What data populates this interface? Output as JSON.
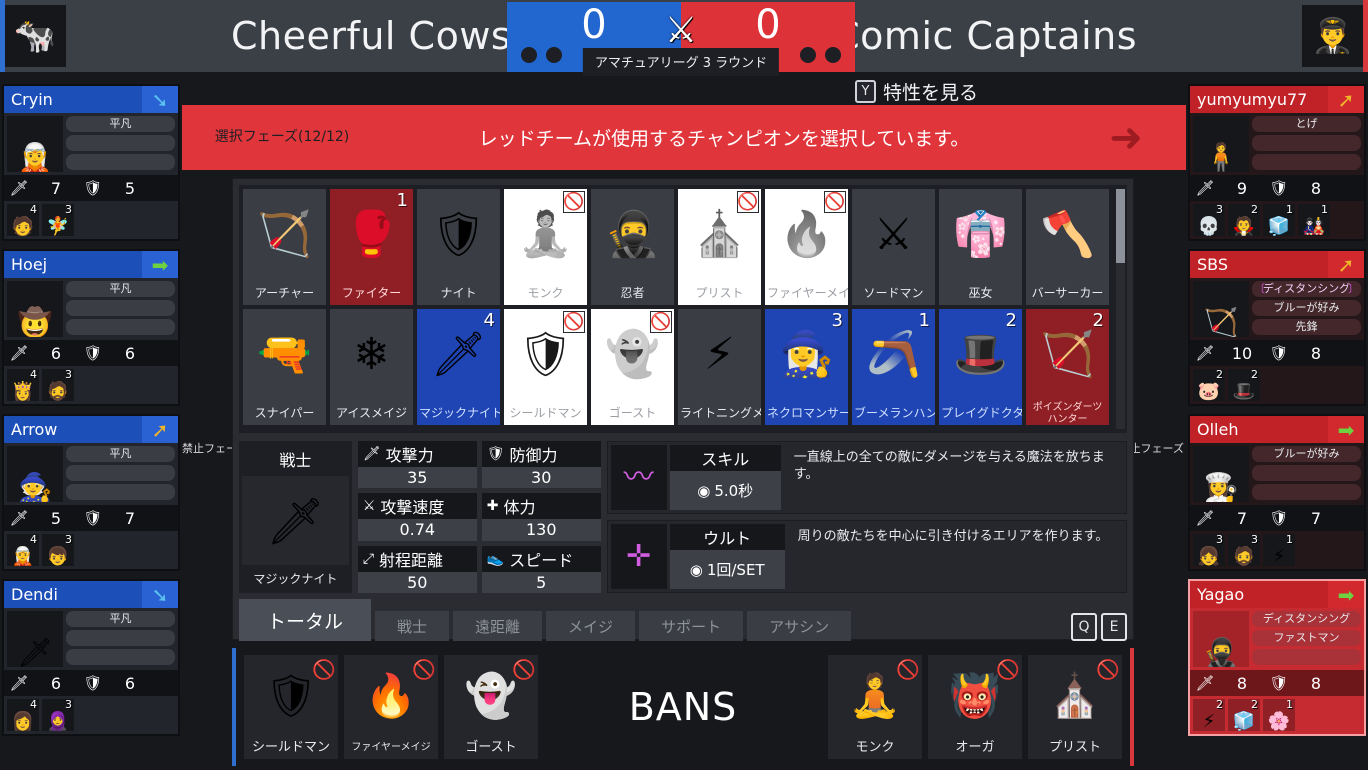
{
  "header": {
    "blue_team": "Cheerful Cows",
    "red_team": "Comic Captains",
    "blue_logo_icon": "cow-icon",
    "red_logo_icon": "captain-icon",
    "blue_score": "0",
    "red_score": "0",
    "round_label": "アマチュアリーグ 3 ラウンド",
    "swords_icon": "crossed-swords-icon",
    "traits_key": "Y",
    "traits_label": "特性を見る"
  },
  "phase": {
    "count": "選択フェーズ(12/12)",
    "message": "レッドチームが使用するチャンピオンを選択しています。",
    "arrow_icon": "arrow-right-icon",
    "ban_tag_left": "禁止フェーズ",
    "ban_tag_right": "禁止フェーズ"
  },
  "blue_players": [
    {
      "name": "Cryin",
      "arrow": "arrow-down-right-icon",
      "portrait": "🧝",
      "traits": [
        "平凡",
        "",
        ""
      ],
      "attack": "7",
      "defense": "5",
      "champs": [
        {
          "icon": "🧑",
          "count": "4"
        },
        {
          "icon": "🧚",
          "count": "3"
        }
      ]
    },
    {
      "name": "Hoej",
      "arrow": "arrow-right-icon",
      "portrait": "🤠",
      "traits": [
        "平凡",
        "",
        ""
      ],
      "attack": "6",
      "defense": "6",
      "champs": [
        {
          "icon": "👸",
          "count": "4"
        },
        {
          "icon": "🧔",
          "count": "3"
        }
      ]
    },
    {
      "name": "Arrow",
      "arrow": "arrow-up-right-icon",
      "portrait": "🧙",
      "traits": [
        "平凡",
        "",
        ""
      ],
      "attack": "5",
      "defense": "7",
      "champs": [
        {
          "icon": "🧝",
          "count": "4"
        },
        {
          "icon": "👦",
          "count": "3"
        }
      ]
    },
    {
      "name": "Dendi",
      "arrow": "arrow-down-right-icon",
      "portrait": "🗡",
      "traits": [
        "平凡",
        "",
        ""
      ],
      "attack": "6",
      "defense": "6",
      "champs": [
        {
          "icon": "👩",
          "count": "4"
        },
        {
          "icon": "🧕",
          "count": "3"
        }
      ]
    }
  ],
  "red_players": [
    {
      "name": "yumyumyu77",
      "arrow": "arrow-up-right-icon",
      "portrait": "🧍",
      "traits": [
        "とげ",
        "",
        ""
      ],
      "attack": "9",
      "defense": "8",
      "active": false,
      "champs": [
        {
          "icon": "💀",
          "count": "3"
        },
        {
          "icon": "🧛",
          "count": "2"
        },
        {
          "icon": "🧊",
          "count": "1"
        },
        {
          "icon": "🎎",
          "count": "1"
        }
      ]
    },
    {
      "name": "SBS",
      "arrow": "arrow-up-right-icon",
      "portrait": "🏹",
      "traits": [
        "ディスタンシング",
        "ブルーが好み",
        "先鋒"
      ],
      "attack": "10",
      "defense": "8",
      "active": false,
      "trait_special": true,
      "champs": [
        {
          "icon": "🐷",
          "count": "2"
        },
        {
          "icon": "🎩",
          "count": "2"
        }
      ]
    },
    {
      "name": "Olleh",
      "arrow": "arrow-right-icon",
      "portrait": "👩‍🍳",
      "traits": [
        "ブルーが好み",
        "",
        ""
      ],
      "attack": "7",
      "defense": "7",
      "active": false,
      "champs": [
        {
          "icon": "👧",
          "count": "3"
        },
        {
          "icon": "🧔",
          "count": "3"
        },
        {
          "icon": "⚡",
          "count": "1"
        }
      ]
    },
    {
      "name": "Yagao",
      "arrow": "arrow-right-icon",
      "portrait": "🥷",
      "traits": [
        "ディスタンシング",
        "ファストマン",
        ""
      ],
      "attack": "8",
      "defense": "8",
      "active": true,
      "champs": [
        {
          "icon": "⚡",
          "count": "2"
        },
        {
          "icon": "🧊",
          "count": "2"
        },
        {
          "icon": "🌸",
          "count": "1"
        }
      ]
    }
  ],
  "champion_grid": {
    "row1": [
      {
        "name": "アーチャー",
        "icon": "🏹",
        "state": "normal",
        "count": ""
      },
      {
        "name": "ファイター",
        "icon": "🥊",
        "state": "sel-red",
        "count": "1"
      },
      {
        "name": "ナイト",
        "icon": "🛡",
        "state": "normal",
        "count": ""
      },
      {
        "name": "モンク",
        "icon": "🧘",
        "state": "banned",
        "count": ""
      },
      {
        "name": "忍者",
        "icon": "🥷",
        "state": "normal",
        "count": ""
      },
      {
        "name": "プリスト",
        "icon": "⛪",
        "state": "banned",
        "count": ""
      },
      {
        "name": "ファイヤーメイジ",
        "icon": "🔥",
        "state": "banned",
        "count": ""
      },
      {
        "name": "ソードマン",
        "icon": "⚔",
        "state": "normal",
        "count": ""
      },
      {
        "name": "巫女",
        "icon": "👘",
        "state": "normal",
        "count": ""
      },
      {
        "name": "バーサーカー",
        "icon": "🪓",
        "state": "normal",
        "count": ""
      }
    ],
    "row2": [
      {
        "name": "スナイパー",
        "icon": "🔫",
        "state": "normal",
        "count": ""
      },
      {
        "name": "アイスメイジ",
        "icon": "❄",
        "state": "normal",
        "count": ""
      },
      {
        "name": "マジックナイト",
        "icon": "🗡",
        "state": "sel-blue",
        "count": "4"
      },
      {
        "name": "シールドマン",
        "icon": "🛡",
        "state": "banned",
        "count": ""
      },
      {
        "name": "ゴースト",
        "icon": "👻",
        "state": "banned",
        "count": ""
      },
      {
        "name": "ライトニングメイジ",
        "icon": "⚡",
        "state": "normal",
        "count": ""
      },
      {
        "name": "ネクロマンサー",
        "icon": "🧙‍♀",
        "state": "sel-blue",
        "count": "3"
      },
      {
        "name": "ブーメランハンター",
        "icon": "🪃",
        "state": "sel-blue",
        "count": "1"
      },
      {
        "name": "プレイグドクター",
        "icon": "🎩",
        "state": "sel-blue",
        "count": "2"
      },
      {
        "name": "ポイズンダーツハンター",
        "icon": "🏹",
        "state": "sel-red",
        "count": "2"
      }
    ]
  },
  "detail": {
    "role": "戦士",
    "champion_name": "マジックナイト",
    "champion_icon": "🗡",
    "stats": [
      {
        "icon": "sword-icon",
        "glyph": "🗡",
        "label": "攻撃力",
        "value": "35"
      },
      {
        "icon": "shield-icon",
        "glyph": "🛡",
        "label": "防御力",
        "value": "30"
      },
      {
        "icon": "attack-speed-icon",
        "glyph": "⚔",
        "label": "攻撃速度",
        "value": "0.74"
      },
      {
        "icon": "health-icon",
        "glyph": "✚",
        "label": "体力",
        "value": "130"
      },
      {
        "icon": "range-icon",
        "glyph": "⤢",
        "label": "射程距離",
        "value": "50"
      },
      {
        "icon": "speed-icon",
        "glyph": "👟",
        "label": "スピード",
        "value": "5"
      }
    ],
    "skills": [
      {
        "name": "スキル",
        "icon": "magic-wave-icon",
        "glyph": "〰",
        "cooldown": "5.0秒",
        "desc": "一直線上の全ての敵にダメージを与える魔法を放ちます。"
      },
      {
        "name": "ウルト",
        "icon": "magic-pillar-icon",
        "glyph": "✛",
        "cooldown": "1回/SET",
        "desc": "周りの敵たちを中心に引き付けるエリアを作ります。"
      }
    ]
  },
  "tabs": {
    "items": [
      {
        "label": "トータル",
        "active": true
      },
      {
        "label": "戦士",
        "active": false
      },
      {
        "label": "遠距離",
        "active": false
      },
      {
        "label": "メイジ",
        "active": false
      },
      {
        "label": "サポート",
        "active": false
      },
      {
        "label": "アサシン",
        "active": false
      }
    ],
    "keys": [
      "Q",
      "E"
    ]
  },
  "bans": {
    "title": "BANS",
    "blue": [
      {
        "name": "シールドマン",
        "icon": "🛡",
        "small": false
      },
      {
        "name": "ファイヤーメイジ",
        "icon": "🔥",
        "small": true
      },
      {
        "name": "ゴースト",
        "icon": "👻",
        "small": false
      }
    ],
    "red": [
      {
        "name": "モンク",
        "icon": "🧘",
        "small": false
      },
      {
        "name": "オーガ",
        "icon": "👹",
        "small": false
      },
      {
        "name": "プリスト",
        "icon": "⛪",
        "small": false
      }
    ],
    "ban_mark_icon": "no-entry-icon"
  }
}
